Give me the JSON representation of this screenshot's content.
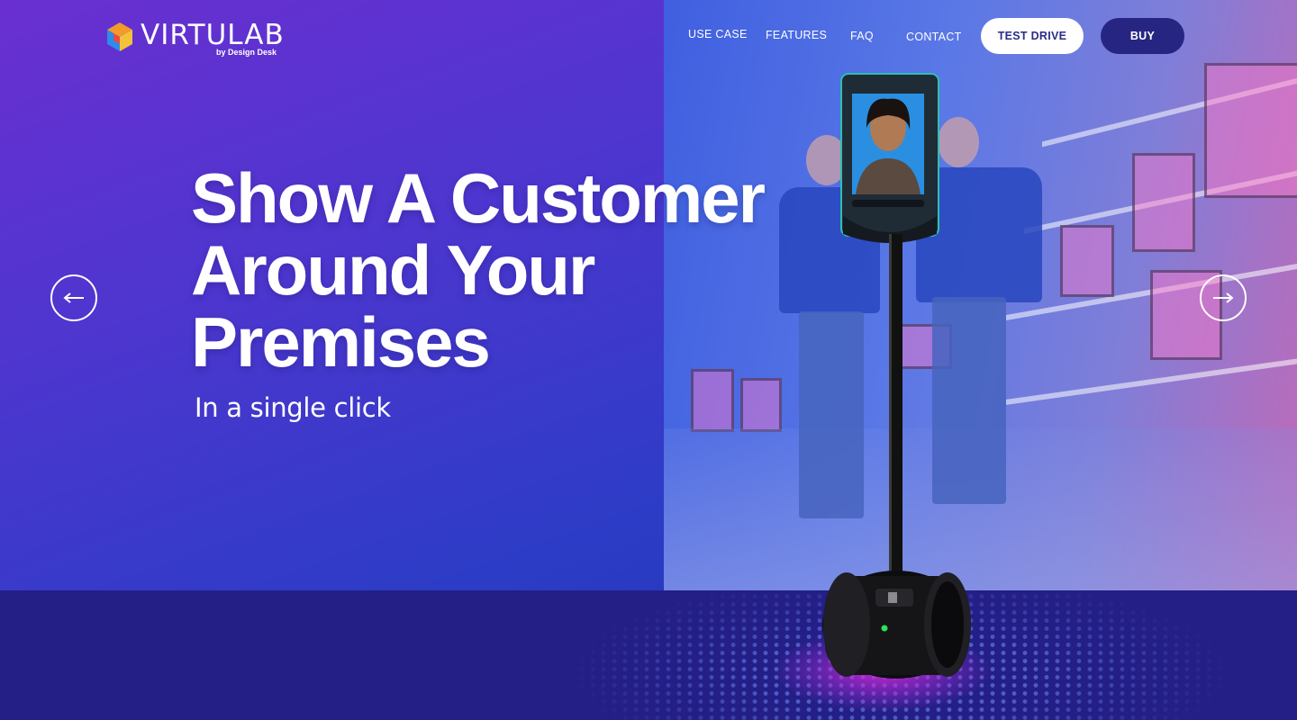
{
  "brand": {
    "name": "VIRTULAB",
    "tagline": "by Design Desk"
  },
  "nav": {
    "links": [
      "USE CASE",
      "FEATURES",
      "FAQ",
      "CONTACT"
    ],
    "test_drive_label": "TEST DRIVE",
    "buy_label": "BUY"
  },
  "hero": {
    "headline_lines": [
      "Show A Customer",
      "Around Your",
      "Premises"
    ],
    "subline": "In a single click"
  },
  "carousel": {
    "prev_icon": "arrow-left-icon",
    "next_icon": "arrow-right-icon"
  },
  "colors": {
    "hero_gradient_start": "#6a2fd0",
    "hero_gradient_end": "#1f36b6",
    "floor": "#231f86",
    "buy_button": "#262582",
    "test_drive_text": "#2a2c8a"
  }
}
